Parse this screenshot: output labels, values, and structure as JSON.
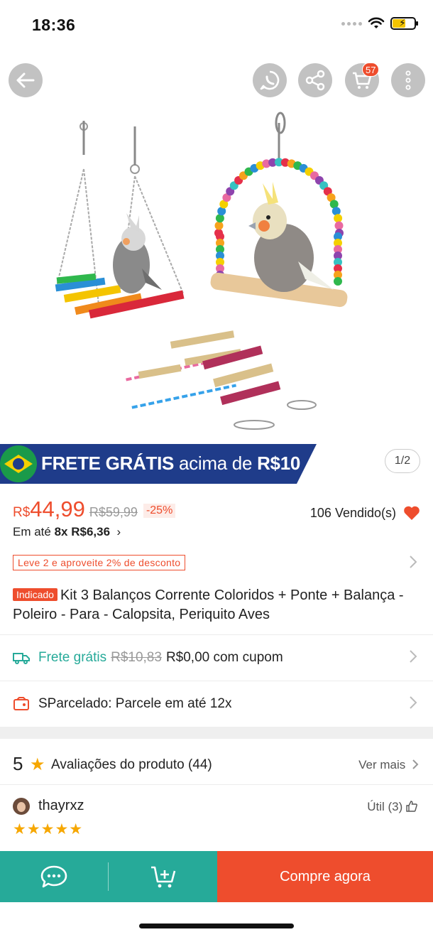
{
  "status_bar": {
    "time": "18:36"
  },
  "header": {
    "cart_count": "57"
  },
  "gallery": {
    "page_indicator": "1/2"
  },
  "promo": {
    "bold": "FRETE GRÁTIS",
    "light": "acima de",
    "amount": "R$10"
  },
  "price": {
    "currency": "R$",
    "value": "44,99",
    "original": "R$59,99",
    "discount": "-25%",
    "sold": "106 Vendido(s)",
    "installment_prefix": "Em até",
    "installment_bold": "8x R$6,36",
    "installment_arrow": "›",
    "bundle_offer": "Leve 2 e aproveite 2% de desconto"
  },
  "product": {
    "badge": "Indicado",
    "title": "Kit 3 Balanços Corrente Coloridos + Ponte + Balança - Poleiro - Para - Calopsita, Periquito Aves"
  },
  "shipping": {
    "label": "Frete grátis",
    "old_price": "R$10,83",
    "new_price": "R$0,00 com cupom"
  },
  "parcel": {
    "label": "SParcelado: Parcele em até 12x"
  },
  "reviews": {
    "rating": "5",
    "label": "Avaliações do produto",
    "count": "(44)",
    "see_more": "Ver mais",
    "first": {
      "user": "thayrxz",
      "useful": "Útil (3)",
      "stars": "★★★★★"
    }
  },
  "bottom": {
    "buy_label": "Compre agora"
  },
  "colors": {
    "accent": "#ee4d2d",
    "green": "#26aa99",
    "star": "#f6a700",
    "banner_blue": "#1f3c8a"
  }
}
